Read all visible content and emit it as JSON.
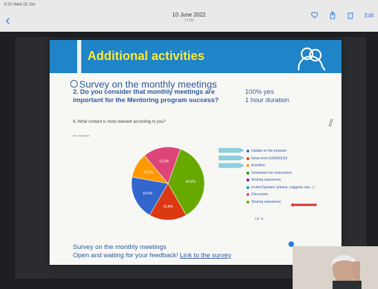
{
  "status": {
    "text": "9:32 Wed 15 Jun"
  },
  "header": {
    "date": "10 June 2022",
    "time": "17:09",
    "edit_label": "Edit"
  },
  "slide": {
    "title": "Additional activities",
    "section_heading": "Survey on the monthly meetings",
    "question": "2. Do you consider that monthly meetings are important for the Mentoring program success?",
    "answer_1": "100% yes",
    "answer_2": "1 hour duration",
    "form_question": "6. What content is most relevant according to you?",
    "responses": "38 responses",
    "pager": "1/2",
    "bottom_line_1": "Survey on the monthly meetings",
    "bottom_line_2_prefix": "Open and waiting for your feedback! ",
    "bottom_link": "Link to the survey"
  },
  "chart_data": {
    "type": "pie",
    "labels": [
      "Update on the program",
      "News from EURAXESS",
      "Activities",
      "Orientation for newcomers",
      "Sharing experience",
      "Invited Speaker (please, suggests one...)",
      "Discussion",
      "Sharing experience"
    ],
    "values": [
      18.4,
      15.8,
      0,
      0,
      0,
      10.5,
      15.8,
      34.2
    ],
    "colors": [
      "#3366cc",
      "#dc3912",
      "#ff9900",
      "#109618",
      "#990099",
      "#0099c6",
      "#dd4477",
      "#66aa00"
    ],
    "data_labels": [
      "34.2%",
      "15.8%",
      "18.4%",
      "10.5%",
      "15.8%"
    ]
  }
}
